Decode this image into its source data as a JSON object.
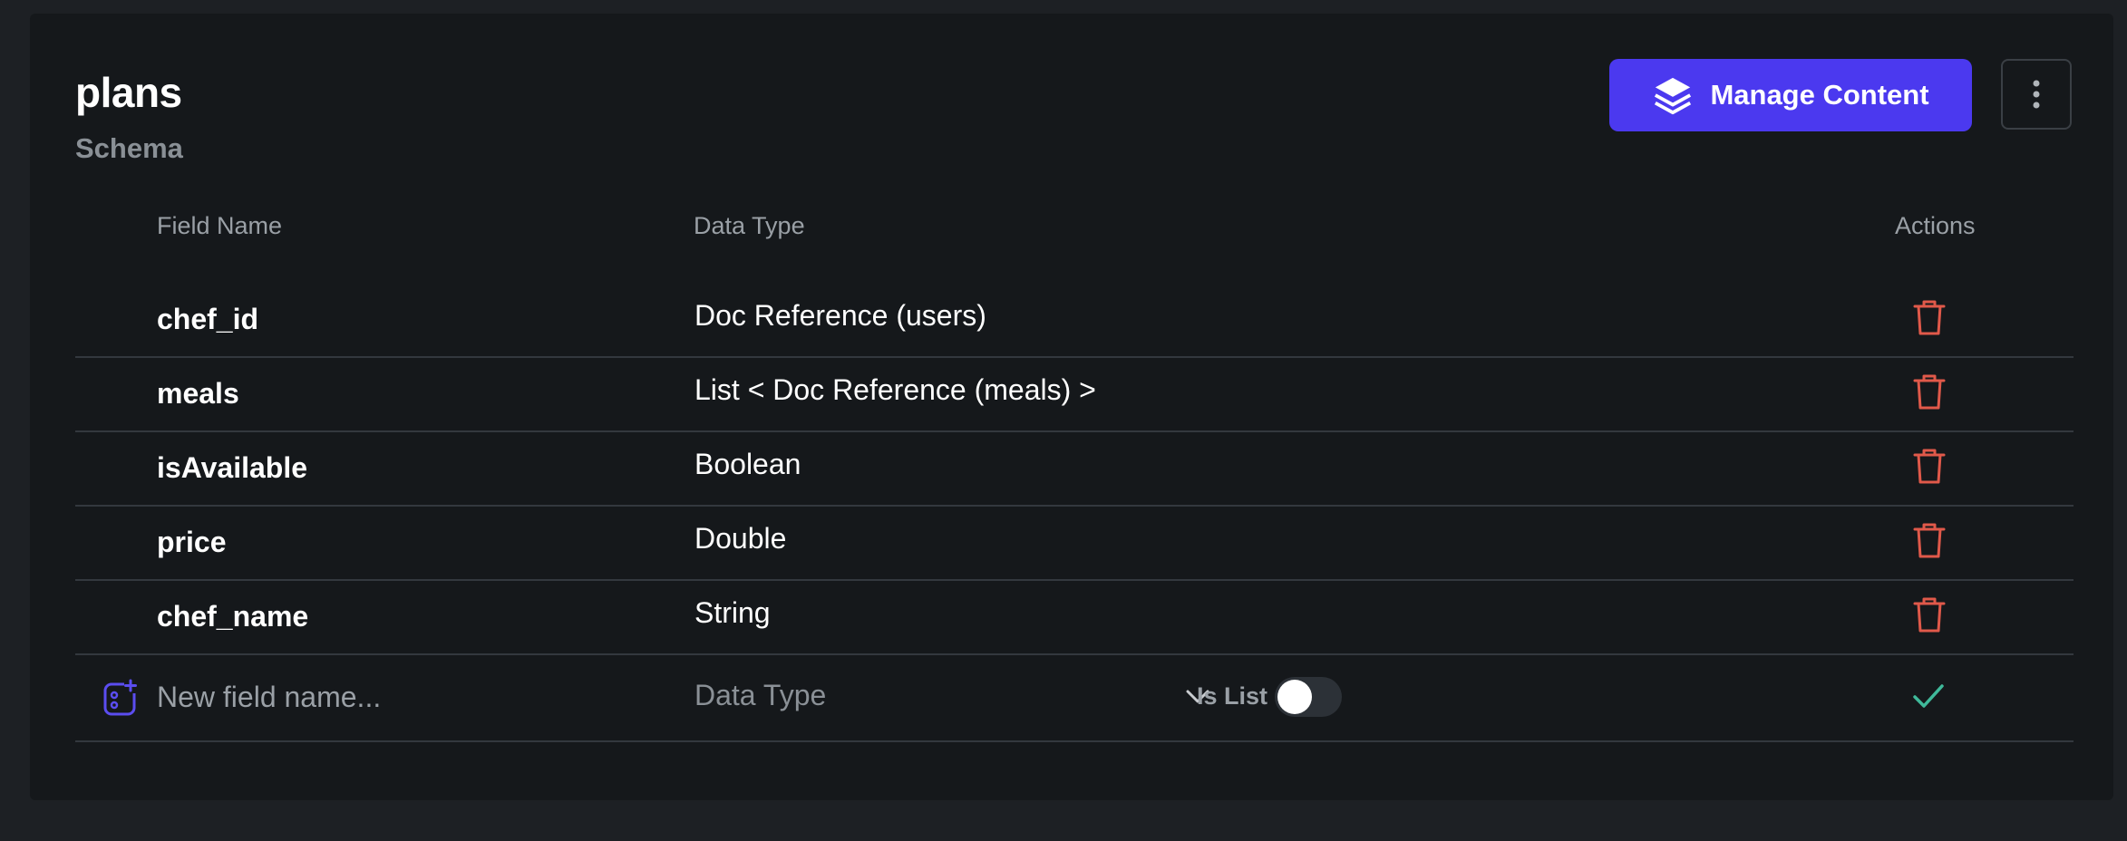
{
  "header": {
    "title": "plans",
    "subtitle": "Schema",
    "manage_button_label": "Manage Content",
    "colors": {
      "accent": "#4b39ef",
      "danger": "#e0594a",
      "success": "#3fb99a"
    }
  },
  "table": {
    "columns": {
      "field_name": "Field Name",
      "data_type": "Data Type",
      "actions": "Actions"
    },
    "rows": [
      {
        "name": "chef_id",
        "type": "Doc Reference (users)",
        "action_icon": "trash-icon"
      },
      {
        "name": "meals",
        "type": "List < Doc Reference (meals) >",
        "action_icon": "trash-icon"
      },
      {
        "name": "isAvailable",
        "type": "Boolean",
        "action_icon": "trash-icon"
      },
      {
        "name": "price",
        "type": "Double",
        "action_icon": "trash-icon"
      },
      {
        "name": "chef_name",
        "type": "String",
        "action_icon": "trash-icon"
      }
    ]
  },
  "new_field": {
    "name_placeholder": "New field name...",
    "data_type_placeholder": "Data Type",
    "is_list_label": "Is List",
    "is_list_value": false
  }
}
